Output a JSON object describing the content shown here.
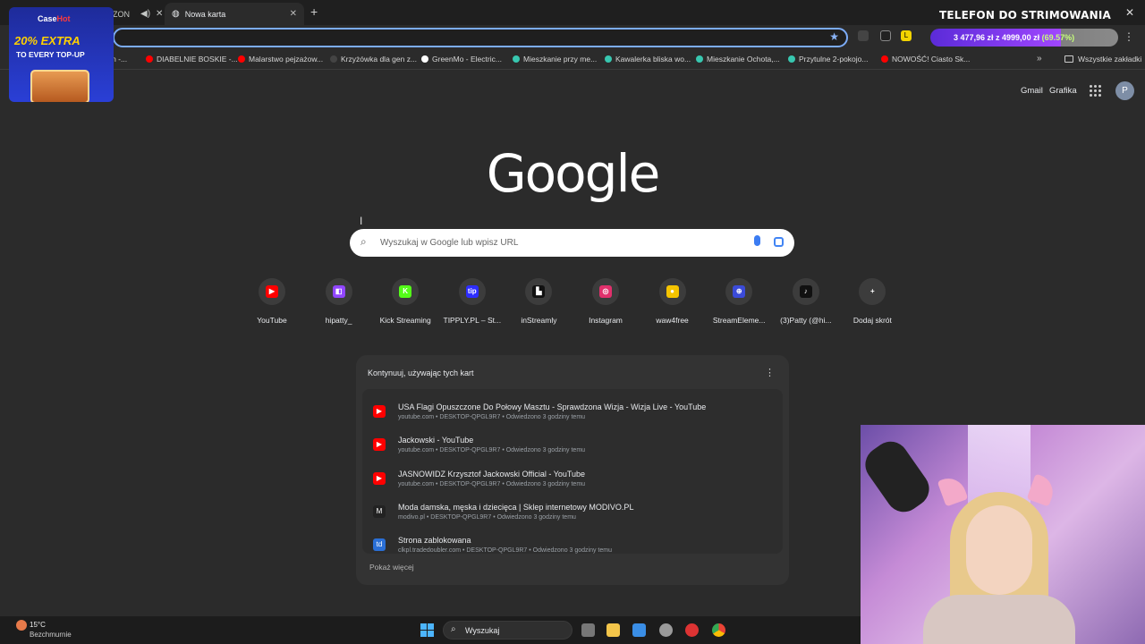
{
  "browser": {
    "inactive_tab_label": "EZON",
    "active_tab_label": "Nowa karta",
    "overlay_title": "TELEFON DO STRIMOWANIA",
    "omnibox_value": "",
    "goal_progress": {
      "text_main": "3 477,96 zł z 4999,00 zł ",
      "text_pct": "(69.57%)",
      "fraction": 0.6957,
      "fill_color": "#a046ff"
    }
  },
  "bookmarks": {
    "items": [
      {
        "label": "um -...",
        "color": "#cccccc"
      },
      {
        "label": "DIABELNIE BOSKIE -...",
        "color": "#ff0000"
      },
      {
        "label": "Malarstwo pejzażow...",
        "color": "#ff0000"
      },
      {
        "label": "Krzyżówka dla gen z...",
        "color": "#444444"
      },
      {
        "label": "GreenMo - Electric...",
        "color": "#ffffff"
      },
      {
        "label": "Mieszkanie przy me...",
        "color": "#38c7b0"
      },
      {
        "label": "Kawalerka bliska wo...",
        "color": "#38c7b0"
      },
      {
        "label": "Mieszkanie Ochota,...",
        "color": "#38c7b0"
      },
      {
        "label": "Przytulne 2-pokojo...",
        "color": "#38c7b0"
      },
      {
        "label": "NOWOŚĆ! Ciasto Sk...",
        "color": "#ff0000"
      }
    ],
    "all_label": "Wszystkie zakładki"
  },
  "ad": {
    "logo_a": "Case",
    "logo_b": "Hot",
    "line1": "20% EXTRA",
    "line2": "TO EVERY TOP-UP"
  },
  "header": {
    "gmail": "Gmail",
    "grafika": "Grafika",
    "avatar": "P"
  },
  "logo": "Google",
  "search": {
    "placeholder": "Wyszukaj w Google lub wpisz URL"
  },
  "shortcuts": [
    {
      "label": "YouTube",
      "icon": "youtube-icon",
      "color": "#ff0000",
      "glyph": "▶"
    },
    {
      "label": "hipatty_",
      "icon": "twitch-icon",
      "color": "#9146ff",
      "glyph": "◧"
    },
    {
      "label": "Kick Streaming",
      "icon": "kick-icon",
      "color": "#53fc18",
      "glyph": "K"
    },
    {
      "label": "TIPPLY.PL – St...",
      "icon": "tipply-icon",
      "color": "#2d2dff",
      "glyph": "tip"
    },
    {
      "label": "inStreamly",
      "icon": "instreamly-icon",
      "color": "#111111",
      "glyph": "▙"
    },
    {
      "label": "Instagram",
      "icon": "instagram-icon",
      "color": "#e1306c",
      "glyph": "◎"
    },
    {
      "label": "waw4free",
      "icon": "waw4free-icon",
      "color": "#f5c400",
      "glyph": "●"
    },
    {
      "label": "StreamEleme...",
      "icon": "streamelements-icon",
      "color": "#3b4bd8",
      "glyph": "⊕"
    },
    {
      "label": "(3)Patty (@hi...",
      "icon": "tiktok-icon",
      "color": "#111111",
      "glyph": "♪"
    },
    {
      "label": "Dodaj skrót",
      "icon": "plus-icon",
      "color": "#3c3c3c",
      "glyph": "+"
    }
  ],
  "continue_card": {
    "title": "Kontynuuj, używając tych kart",
    "more": "Pokaż więcej",
    "rows": [
      {
        "title": "USA Flagi Opuszczone Do Połowy Masztu - Sprawdzona Wizja - Wizja Live - YouTube",
        "sub": "youtube.com • DESKTOP-QPGL9R7 • Odwiedzono 3 godziny temu",
        "icon": "youtube-icon",
        "color": "#ff0000",
        "glyph": "▶"
      },
      {
        "title": "Jackowski - YouTube",
        "sub": "youtube.com • DESKTOP-QPGL9R7 • Odwiedzono 3 godziny temu",
        "icon": "youtube-icon",
        "color": "#ff0000",
        "glyph": "▶"
      },
      {
        "title": "JASNOWIDZ Krzysztof Jackowski Official - YouTube",
        "sub": "youtube.com • DESKTOP-QPGL9R7 • Odwiedzono 3 godziny temu",
        "icon": "youtube-icon",
        "color": "#ff0000",
        "glyph": "▶"
      },
      {
        "title": "Moda damska, męska i dziecięca | Sklep internetowy MODIVO.PL",
        "sub": "modivo.pl • DESKTOP-QPGL9R7 • Odwiedzono 3 godziny temu",
        "icon": "modivo-icon",
        "color": "#222222",
        "glyph": "M"
      },
      {
        "title": "Strona zablokowana",
        "sub": "clkpl.tradedoubler.com • DESKTOP-QPGL9R7 • Odwiedzono 3 godziny temu",
        "icon": "tradedoubler-icon",
        "color": "#2a6fd6",
        "glyph": "td"
      }
    ]
  },
  "taskbar": {
    "temperature": "15°C",
    "weather": "Bezchmurnie",
    "search": "Wyszukaj"
  }
}
